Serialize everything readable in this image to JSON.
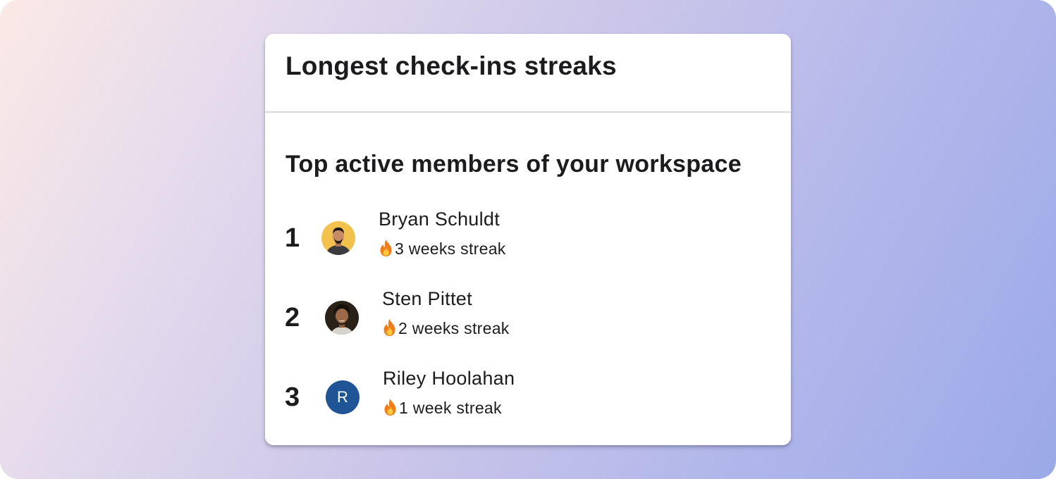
{
  "card": {
    "title": "Longest check-ins streaks",
    "subtitle": "Top active members of your workspace"
  },
  "members": [
    {
      "rank": "1",
      "name": "Bryan Schuldt",
      "streak": "3 weeks streak",
      "avatar": "photo-avatar",
      "avatar_bg": "#f2c14e"
    },
    {
      "rank": "2",
      "name": "Sten Pittet",
      "streak": "2 weeks streak",
      "avatar": "photo-avatar",
      "avatar_bg": "#2a2118"
    },
    {
      "rank": "3",
      "name": "Riley Hoolahan",
      "streak": "1 week streak",
      "avatar": "initial-avatar",
      "initial": "R",
      "avatar_bg": "#1f5597"
    }
  ],
  "icons": {
    "streak": "fire-icon"
  },
  "colors": {
    "card_bg": "#ffffff",
    "text": "#1c1c1e",
    "divider": "#d9d9de",
    "background_start": "#fbe9e6",
    "background_end": "#9ba9e8"
  }
}
